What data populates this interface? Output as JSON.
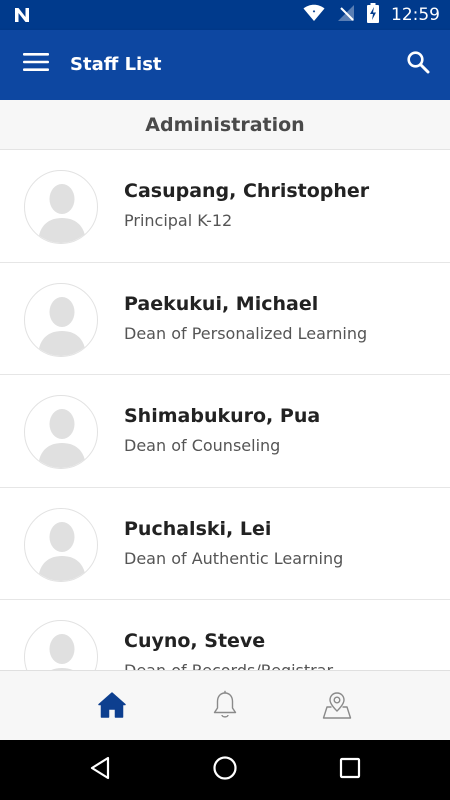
{
  "status_bar": {
    "time": "12:59",
    "icons": [
      "n-notification-icon",
      "wifi-icon",
      "no-signal-icon",
      "battery-charging-icon"
    ]
  },
  "app_bar": {
    "title": "Staff List",
    "menu_icon": "hamburger-menu-icon",
    "search_icon": "search-icon"
  },
  "section": {
    "title": "Administration"
  },
  "staff": [
    {
      "name": "Casupang, Christopher",
      "role": "Principal K-12"
    },
    {
      "name": "Paekukui, Michael",
      "role": "Dean of Personalized Learning"
    },
    {
      "name": "Shimabukuro, Pua",
      "role": "Dean of Counseling"
    },
    {
      "name": "Puchalski, Lei",
      "role": "Dean of Authentic Learning"
    },
    {
      "name": "Cuyno, Steve",
      "role": "Dean of Records/Registrar"
    }
  ],
  "bottom_nav": {
    "items": [
      "home-icon",
      "notifications-bell-icon",
      "map-location-icon"
    ],
    "active": "home-icon"
  },
  "colors": {
    "status_bar": "#003a8c",
    "app_bar": "#0d47a1",
    "active_nav": "#0d3f8f",
    "inactive_nav": "#8a8a8a"
  }
}
